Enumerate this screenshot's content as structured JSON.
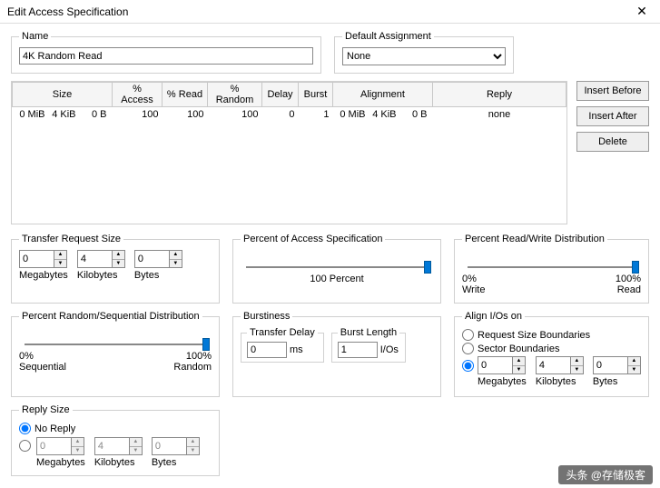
{
  "window": {
    "title": "Edit Access Specification"
  },
  "name": {
    "legend": "Name",
    "value": "4K Random Read"
  },
  "assignment": {
    "legend": "Default Assignment",
    "value": "None"
  },
  "table": {
    "headers": {
      "size": "Size",
      "access": "% Access",
      "read": "% Read",
      "random": "% Random",
      "delay": "Delay",
      "burst": "Burst",
      "alignment": "Alignment",
      "reply": "Reply"
    },
    "row": {
      "size_mib": "0 MiB",
      "size_kib": "4 KiB",
      "size_b": "0 B",
      "access": "100",
      "read": "100",
      "random": "100",
      "delay": "0",
      "burst": "1",
      "align_mib": "0 MiB",
      "align_kib": "4 KiB",
      "align_b": "0 B",
      "reply": "none"
    }
  },
  "buttons": {
    "insert_before": "Insert Before",
    "insert_after": "Insert After",
    "delete": "Delete"
  },
  "trs": {
    "legend": "Transfer Request Size",
    "mb": {
      "label": "Megabytes",
      "value": "0"
    },
    "kb": {
      "label": "Kilobytes",
      "value": "4"
    },
    "b": {
      "label": "Bytes",
      "value": "0"
    }
  },
  "pas": {
    "legend": "Percent of Access Specification",
    "center": "100 Percent"
  },
  "prw": {
    "legend": "Percent Read/Write Distribution",
    "left_pct": "0%",
    "left_lbl": "Write",
    "right_pct": "100%",
    "right_lbl": "Read"
  },
  "prs": {
    "legend": "Percent Random/Sequential Distribution",
    "left_pct": "0%",
    "left_lbl": "Sequential",
    "right_pct": "100%",
    "right_lbl": "Random"
  },
  "burst": {
    "legend": "Burstiness",
    "delay": {
      "legend": "Transfer Delay",
      "value": "0",
      "unit": "ms"
    },
    "length": {
      "legend": "Burst Length",
      "value": "1",
      "unit": "I/Os"
    }
  },
  "align": {
    "legend": "Align I/Os on",
    "opt_request": "Request Size Boundaries",
    "opt_sector": "Sector Boundaries",
    "mb": {
      "label": "Megabytes",
      "value": "0"
    },
    "kb": {
      "label": "Kilobytes",
      "value": "4"
    },
    "b": {
      "label": "Bytes",
      "value": "0"
    }
  },
  "reply": {
    "legend": "Reply Size",
    "opt_noreply": "No Reply",
    "mb": {
      "label": "Megabytes",
      "value": "0"
    },
    "kb": {
      "label": "Kilobytes",
      "value": "4"
    },
    "b": {
      "label": "Bytes",
      "value": "0"
    }
  },
  "watermark": "头条 @存储极客"
}
